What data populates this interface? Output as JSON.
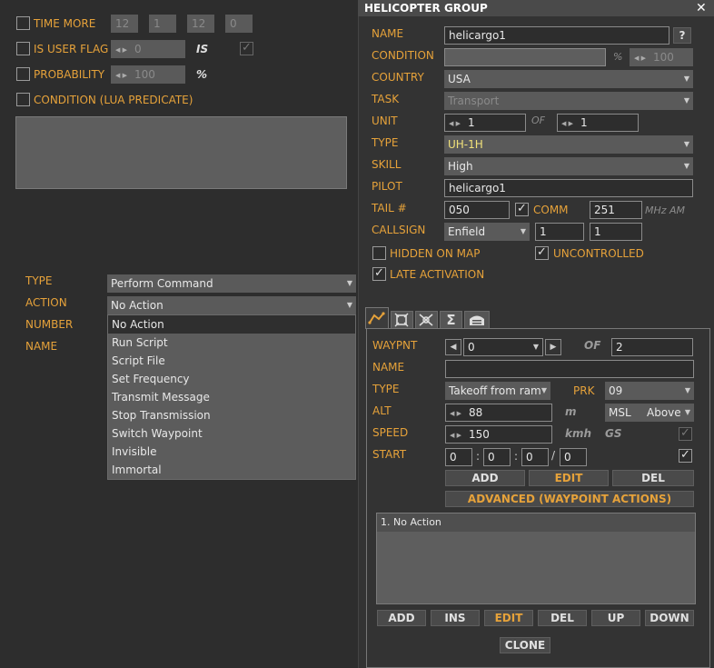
{
  "left": {
    "time_more": {
      "label": "TIME MORE",
      "v1": "12",
      "v2": "1",
      "v3": "12",
      "v4": "0"
    },
    "is_user_flag": {
      "label": "IS USER FLAG",
      "value": "0",
      "is_label": "IS"
    },
    "probability": {
      "label": "PROBABILITY",
      "value": "100",
      "unit": "%"
    },
    "condition_lua": {
      "label": "CONDITION (LUA PREDICATE)"
    },
    "type": {
      "label": "TYPE",
      "value": "Perform Command"
    },
    "action": {
      "label": "ACTION",
      "value": "No Action"
    },
    "number": {
      "label": "NUMBER"
    },
    "name": {
      "label": "NAME"
    },
    "action_options": [
      "No Action",
      "Run Script",
      "Script File",
      "Set Frequency",
      "Transmit Message",
      "Stop Transmission",
      "Switch Waypoint",
      "Invisible",
      "Immortal"
    ]
  },
  "group": {
    "title": "HELICOPTER GROUP",
    "close": "✕",
    "name_label": "NAME",
    "name_value": "helicargo1",
    "help": "?",
    "condition_label": "CONDITION",
    "condition_pct": "%",
    "condition_value": "100",
    "country_label": "COUNTRY",
    "country_value": "USA",
    "task_label": "TASK",
    "task_value": "Transport",
    "unit_label": "UNIT",
    "unit_value": "1",
    "of_label": "OF",
    "unit_total": "1",
    "type_label": "TYPE",
    "type_value": "UH-1H",
    "skill_label": "SKILL",
    "skill_value": "High",
    "pilot_label": "PILOT",
    "pilot_value": "helicargo1",
    "tail_label": "TAIL #",
    "tail_value": "050",
    "comm_label": "COMM",
    "comm_value": "251",
    "comm_unit": "MHz AM",
    "callsign_label": "CALLSIGN",
    "callsign_value": "Enfield",
    "callsign_n1": "1",
    "callsign_n2": "1",
    "hidden_label": "HIDDEN ON MAP",
    "uncontrolled_label": "UNCONTROLLED",
    "late_label": "LATE ACTIVATION"
  },
  "waypoint": {
    "wp_label": "WAYPNT",
    "wp_value": "0",
    "of_label": "OF",
    "wp_total": "2",
    "name_label": "NAME",
    "type_label": "TYPE",
    "type_value": "Takeoff from ram",
    "prk_label": "PRK",
    "prk_value": "09",
    "alt_label": "ALT",
    "alt_value": "88",
    "alt_unit": "m",
    "alt_ref": "MSL",
    "alt_ref2": "Above",
    "speed_label": "SPEED",
    "speed_value": "150",
    "speed_unit": "kmh",
    "gs_label": "GS",
    "start_label": "START",
    "start_d": "0",
    "start_h": "0",
    "start_m": "0",
    "start_s": "0",
    "add": "ADD",
    "edit": "EDIT",
    "del": "DEL",
    "advanced": "ADVANCED (WAYPOINT ACTIONS)",
    "actions": [
      "1. No Action"
    ],
    "b_add": "ADD",
    "b_ins": "INS",
    "b_edit": "EDIT",
    "b_del": "DEL",
    "b_up": "UP",
    "b_down": "DOWN",
    "clone": "CLONE"
  }
}
